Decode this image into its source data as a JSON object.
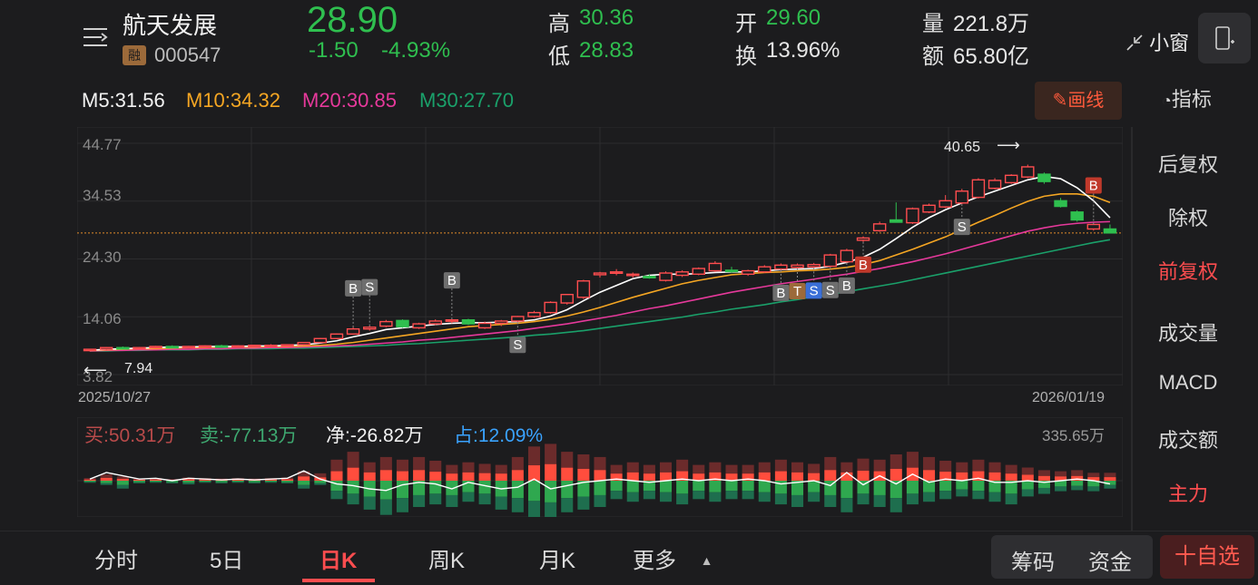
{
  "header": {
    "name": "航天发展",
    "rong": "融",
    "code": "000547",
    "price": "28.90",
    "change": "-1.50",
    "change_pct": "-4.93%",
    "high_label": "高",
    "high": "30.36",
    "low_label": "低",
    "low": "28.83",
    "open_label": "开",
    "open": "29.60",
    "turnover_label": "换",
    "turnover": "13.96%",
    "volume_label": "量",
    "volume": "221.8万",
    "amount_label": "额",
    "amount": "65.80亿",
    "small_window": "小窗"
  },
  "ma": {
    "m5": "M5:31.56",
    "m10": "M10:34.32",
    "m20": "M20:30.85",
    "m30": "M30:27.70"
  },
  "draw_button": "画线",
  "indicator_label": "指标",
  "y_labels": [
    "44.77",
    "34.53",
    "24.30",
    "14.06",
    "3.82"
  ],
  "start_date": "2025/10/27",
  "end_date": "2026/01/19",
  "high_marker": "40.65",
  "low_marker": "7.94",
  "flow": {
    "buy": "买:50.31万",
    "sell": "卖:-77.13万",
    "net": "净:-26.82万",
    "share": "占:12.09%",
    "max": "335.65万"
  },
  "right_menu": [
    "后复权",
    "除权",
    "前复权",
    "成交量",
    "MACD",
    "成交额",
    "主力"
  ],
  "bottom_tabs": [
    "分时",
    "5日",
    "日K",
    "周K",
    "月K",
    "更多"
  ],
  "pill": {
    "left": "筹码",
    "right": "资金"
  },
  "fav": "十自选",
  "colors": {
    "up": "#ff4d4f",
    "down": "#2fbf4f",
    "ma5": "#ffffff",
    "ma10": "#f5a623",
    "ma20": "#e6399b",
    "ma30": "#1aa06a"
  },
  "chart_data": {
    "type": "candlestick",
    "ylim": [
      3.82,
      44.77
    ],
    "candles": [
      [
        8.1,
        8.4,
        7.9,
        8.3
      ],
      [
        8.3,
        8.7,
        8.1,
        8.6
      ],
      [
        8.6,
        8.8,
        8.4,
        8.5
      ],
      [
        8.5,
        8.7,
        8.3,
        8.6
      ],
      [
        8.6,
        8.9,
        8.5,
        8.8
      ],
      [
        8.8,
        9.0,
        8.6,
        8.7
      ],
      [
        8.7,
        8.9,
        8.5,
        8.8
      ],
      [
        8.8,
        9.0,
        8.6,
        8.9
      ],
      [
        8.9,
        9.1,
        8.7,
        8.8
      ],
      [
        8.8,
        9.0,
        8.6,
        8.9
      ],
      [
        8.9,
        9.1,
        8.7,
        9.0
      ],
      [
        9.0,
        9.2,
        8.8,
        9.0
      ],
      [
        9.0,
        9.2,
        8.8,
        9.1
      ],
      [
        9.1,
        9.6,
        9.0,
        9.5
      ],
      [
        9.5,
        10.3,
        9.4,
        10.2
      ],
      [
        10.2,
        11.1,
        10.1,
        11.0
      ],
      [
        11.0,
        12.2,
        10.9,
        11.9
      ],
      [
        11.9,
        12.4,
        11.6,
        12.2
      ],
      [
        12.4,
        13.5,
        12.2,
        13.2
      ],
      [
        13.4,
        13.6,
        12.1,
        12.3
      ],
      [
        12.1,
        13.0,
        11.9,
        12.8
      ],
      [
        12.8,
        13.6,
        12.6,
        13.3
      ],
      [
        13.3,
        13.6,
        12.9,
        13.5
      ],
      [
        13.5,
        13.7,
        12.6,
        12.8
      ],
      [
        12.1,
        13.2,
        11.9,
        12.9
      ],
      [
        12.9,
        13.5,
        12.4,
        13.3
      ],
      [
        13.3,
        14.2,
        13.1,
        14.1
      ],
      [
        14.1,
        15.1,
        13.9,
        14.8
      ],
      [
        14.8,
        16.8,
        14.6,
        16.6
      ],
      [
        16.5,
        18.1,
        16.2,
        18.0
      ],
      [
        17.5,
        20.6,
        17.2,
        20.4
      ],
      [
        21.5,
        22.0,
        21.0,
        21.8
      ],
      [
        21.8,
        22.5,
        21.4,
        22.0
      ],
      [
        21.5,
        21.9,
        21.0,
        21.6
      ],
      [
        21.2,
        21.6,
        20.8,
        21.0
      ],
      [
        20.5,
        22.1,
        20.3,
        21.8
      ],
      [
        21.4,
        22.3,
        21.1,
        22.0
      ],
      [
        21.6,
        22.8,
        21.4,
        22.6
      ],
      [
        22.2,
        23.9,
        22.0,
        23.5
      ],
      [
        22.3,
        22.9,
        21.8,
        22.1
      ],
      [
        21.6,
        22.4,
        21.3,
        22.2
      ],
      [
        22.0,
        23.2,
        21.8,
        22.9
      ],
      [
        22.5,
        23.5,
        22.3,
        23.2
      ],
      [
        22.8,
        23.5,
        22.6,
        23.2
      ],
      [
        22.9,
        23.6,
        22.7,
        23.3
      ],
      [
        23.0,
        25.2,
        22.8,
        25.0
      ],
      [
        23.8,
        26.1,
        23.6,
        25.8
      ],
      [
        27.6,
        28.3,
        27.3,
        28.0
      ],
      [
        29.3,
        30.9,
        29.1,
        30.5
      ],
      [
        31.2,
        34.3,
        31.0,
        30.8
      ],
      [
        30.7,
        33.4,
        30.5,
        33.2
      ],
      [
        32.6,
        34.1,
        32.4,
        33.8
      ],
      [
        33.5,
        35.6,
        33.3,
        34.6
      ],
      [
        34.2,
        36.7,
        34.0,
        36.3
      ],
      [
        35.2,
        38.6,
        35.0,
        38.3
      ],
      [
        36.8,
        38.6,
        36.6,
        38.2
      ],
      [
        37.8,
        39.3,
        37.6,
        39.1
      ],
      [
        38.8,
        41.0,
        38.6,
        40.6
      ],
      [
        39.3,
        39.6,
        37.6,
        38.0
      ],
      [
        34.6,
        35.1,
        33.4,
        33.6
      ],
      [
        32.6,
        32.9,
        30.9,
        31.2
      ],
      [
        29.6,
        30.4,
        29.3,
        30.4
      ],
      [
        29.6,
        30.4,
        28.8,
        28.9
      ]
    ],
    "signals": [
      {
        "i": 16,
        "label": "B",
        "color": "#6e6e6e",
        "pos": "above"
      },
      {
        "i": 17,
        "label": "S",
        "color": "#6e6e6e",
        "pos": "above"
      },
      {
        "i": 22,
        "label": "B",
        "color": "#6e6e6e",
        "pos": "above"
      },
      {
        "i": 26,
        "label": "S",
        "color": "#6e6e6e",
        "pos": "below"
      },
      {
        "i": 42,
        "label": "B",
        "color": "#6e6e6e",
        "pos": "below"
      },
      {
        "i": 43,
        "label": "T",
        "color": "#9c6a3a",
        "pos": "below"
      },
      {
        "i": 44,
        "label": "S",
        "color": "#3a6fd8",
        "pos": "below"
      },
      {
        "i": 45,
        "label": "S",
        "color": "#6e6e6e",
        "pos": "below"
      },
      {
        "i": 46,
        "label": "B",
        "color": "#6e6e6e",
        "pos": "below"
      },
      {
        "i": 47,
        "label": "B",
        "color": "#c0392b",
        "pos": "below"
      },
      {
        "i": 53,
        "label": "S",
        "color": "#6e6e6e",
        "pos": "below"
      },
      {
        "i": 61,
        "label": "B",
        "color": "#c0392b",
        "pos": "above"
      }
    ],
    "ma5": [
      8.1,
      8.3,
      8.4,
      8.5,
      8.6,
      8.7,
      8.7,
      8.8,
      8.8,
      8.8,
      8.9,
      8.9,
      9.0,
      9.1,
      9.4,
      9.8,
      10.5,
      11.1,
      11.8,
      12.1,
      12.4,
      12.7,
      12.9,
      13.0,
      13.0,
      13.1,
      13.2,
      13.5,
      14.2,
      15.3,
      16.9,
      18.4,
      19.6,
      20.8,
      21.4,
      21.6,
      21.6,
      21.7,
      21.9,
      22.0,
      22.0,
      22.2,
      22.4,
      22.5,
      22.6,
      23.0,
      23.7,
      24.6,
      26.0,
      27.9,
      29.9,
      31.6,
      33.0,
      34.2,
      35.3,
      36.3,
      37.3,
      38.3,
      38.9,
      38.5,
      36.9,
      34.6,
      31.6
    ],
    "ma10": [
      8.1,
      8.2,
      8.3,
      8.4,
      8.4,
      8.5,
      8.6,
      8.6,
      8.7,
      8.7,
      8.7,
      8.8,
      8.8,
      8.9,
      9.0,
      9.2,
      9.5,
      9.9,
      10.3,
      10.7,
      11.1,
      11.5,
      11.9,
      12.3,
      12.5,
      12.7,
      12.9,
      13.2,
      13.6,
      14.2,
      14.9,
      15.7,
      16.6,
      17.5,
      18.3,
      19.1,
      19.9,
      20.5,
      21.0,
      21.5,
      21.7,
      21.9,
      22.0,
      22.2,
      22.3,
      22.5,
      22.8,
      23.3,
      24.0,
      25.0,
      26.0,
      27.1,
      28.2,
      29.5,
      30.8,
      32.0,
      33.3,
      34.5,
      35.4,
      35.8,
      35.8,
      35.4,
      34.3
    ],
    "ma20": [
      8.0,
      8.1,
      8.1,
      8.2,
      8.2,
      8.3,
      8.3,
      8.4,
      8.4,
      8.5,
      8.5,
      8.6,
      8.6,
      8.7,
      8.8,
      8.9,
      9.0,
      9.2,
      9.4,
      9.6,
      9.9,
      10.1,
      10.4,
      10.7,
      11.0,
      11.3,
      11.6,
      12.0,
      12.4,
      12.8,
      13.3,
      13.8,
      14.3,
      14.9,
      15.5,
      16.0,
      16.6,
      17.2,
      17.8,
      18.4,
      18.9,
      19.4,
      19.9,
      20.3,
      20.7,
      21.2,
      21.6,
      22.1,
      22.6,
      23.2,
      23.8,
      24.5,
      25.2,
      26.0,
      26.8,
      27.6,
      28.4,
      29.2,
      29.8,
      30.3,
      30.6,
      30.8,
      30.9
    ],
    "ma30": [
      8.0,
      8.0,
      8.1,
      8.1,
      8.2,
      8.2,
      8.2,
      8.3,
      8.3,
      8.4,
      8.4,
      8.4,
      8.5,
      8.5,
      8.6,
      8.7,
      8.8,
      8.9,
      9.0,
      9.2,
      9.3,
      9.5,
      9.7,
      9.9,
      10.1,
      10.3,
      10.5,
      10.8,
      11.0,
      11.3,
      11.6,
      12.0,
      12.4,
      12.8,
      13.2,
      13.6,
      14.0,
      14.5,
      14.9,
      15.4,
      15.8,
      16.2,
      16.7,
      17.1,
      17.6,
      18.0,
      18.5,
      19.0,
      19.5,
      20.0,
      20.6,
      21.2,
      21.8,
      22.4,
      23.0,
      23.6,
      24.2,
      24.8,
      25.4,
      26.0,
      26.6,
      27.2,
      27.7
    ],
    "flow_buy": [
      0.05,
      0.12,
      0.08,
      0.04,
      0.05,
      0.03,
      0.06,
      0.05,
      0.04,
      0.05,
      0.04,
      0.05,
      0.06,
      0.18,
      0.14,
      0.4,
      0.55,
      0.35,
      0.45,
      0.4,
      0.45,
      0.38,
      0.3,
      0.35,
      0.32,
      0.3,
      0.45,
      0.65,
      0.7,
      0.55,
      0.5,
      0.45,
      0.3,
      0.35,
      0.3,
      0.35,
      0.4,
      0.3,
      0.35,
      0.3,
      0.3,
      0.35,
      0.4,
      0.35,
      0.32,
      0.45,
      0.35,
      0.42,
      0.4,
      0.5,
      0.55,
      0.45,
      0.38,
      0.35,
      0.4,
      0.35,
      0.3,
      0.25,
      0.2,
      0.18,
      0.2,
      0.15,
      0.15
    ],
    "flow_sell": [
      0.04,
      0.08,
      0.15,
      0.05,
      0.04,
      0.05,
      0.07,
      0.04,
      0.05,
      0.04,
      0.05,
      0.04,
      0.05,
      0.15,
      0.08,
      0.35,
      0.45,
      0.55,
      0.65,
      0.6,
      0.5,
      0.45,
      0.5,
      0.4,
      0.45,
      0.55,
      0.6,
      0.7,
      0.75,
      0.6,
      0.55,
      0.5,
      0.35,
      0.4,
      0.35,
      0.4,
      0.45,
      0.35,
      0.4,
      0.35,
      0.35,
      0.4,
      0.45,
      0.5,
      0.4,
      0.5,
      0.6,
      0.45,
      0.5,
      0.6,
      0.45,
      0.4,
      0.35,
      0.3,
      0.35,
      0.4,
      0.45,
      0.3,
      0.25,
      0.2,
      0.18,
      0.2,
      0.15
    ],
    "flow_line": [
      0.02,
      0.1,
      0.06,
      0.02,
      0.03,
      0.0,
      0.03,
      0.02,
      0.01,
      0.02,
      0.01,
      0.02,
      0.03,
      0.12,
      0.02,
      -0.04,
      -0.06,
      -0.1,
      -0.12,
      -0.05,
      -0.02,
      -0.04,
      -0.1,
      -0.02,
      -0.06,
      -0.1,
      -0.08,
      0.02,
      -0.1,
      -0.06,
      -0.02,
      0.0,
      0.02,
      0.0,
      -0.02,
      0.0,
      0.02,
      0.0,
      0.02,
      0.0,
      0.02,
      0.0,
      -0.04,
      -0.02,
      0.0,
      -0.06,
      0.1,
      -0.05,
      0.06,
      -0.04,
      0.08,
      -0.02,
      0.02,
      0.0,
      0.03,
      -0.02,
      -0.02,
      0.0,
      -0.02,
      0.0,
      0.02,
      0.0,
      -0.04
    ]
  }
}
